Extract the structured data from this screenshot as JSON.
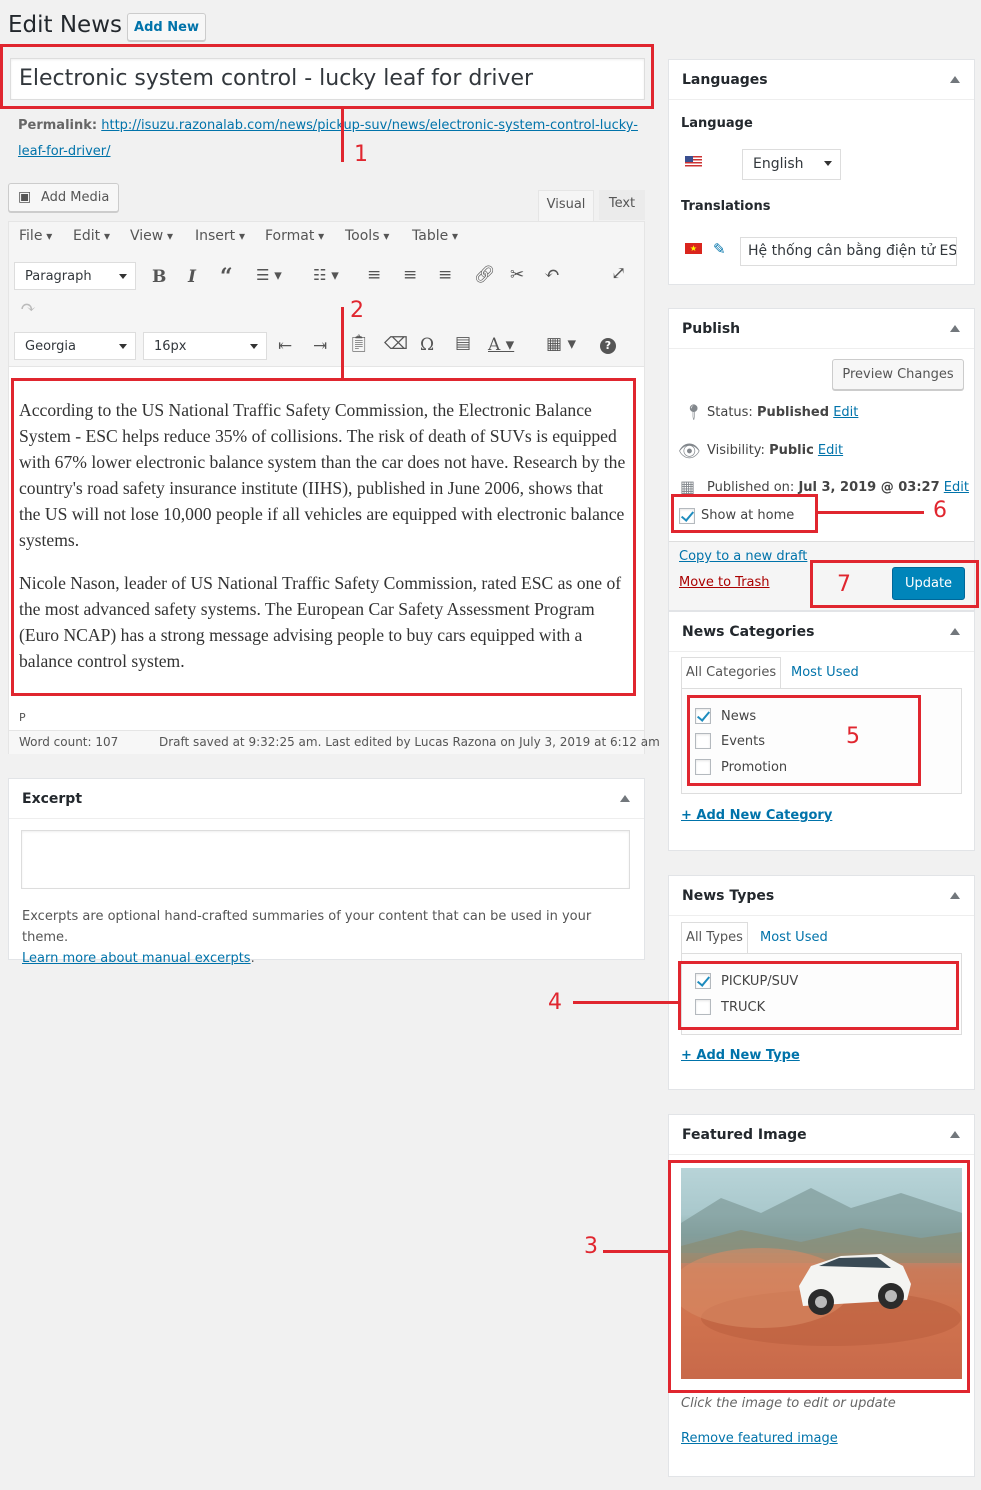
{
  "page": {
    "title": "Edit News",
    "add_new": "Add New",
    "post_title": "Electronic system control - lucky leaf for driver",
    "permalink_label": "Permalink:",
    "permalink_url_line1": "http://isuzu.razonalab.com/news/pickup-suv/news/electronic-system-control-lucky-",
    "permalink_url_line2": "leaf-for-driver/"
  },
  "editor": {
    "add_media": "Add Media",
    "tab_visual": "Visual",
    "tab_text": "Text",
    "menus": [
      "File",
      "Edit",
      "View",
      "Insert",
      "Format",
      "Tools",
      "Table"
    ],
    "paragraph_format": "Paragraph",
    "font_family": "Georgia",
    "font_size": "16px",
    "paragraphs": [
      "According to the US National Traffic Safety Commission, the Electronic Balance System - ESC helps reduce 35% of collisions. The risk of death of SUVs is equipped with 67% lower electronic balance system than the car does not have. Research by the country's road safety insurance institute (IIHS), published in June 2006, shows that the US will not lose 10,000 people if all vehicles are equipped with electronic balance systems.",
      "Nicole Nason, leader of US National Traffic Safety Commission, rated ESC as one of the most advanced safety systems. The European Car Safety Assessment Program (Euro NCAP) has a strong message advising people to buy cars equipped with a balance control system."
    ],
    "path": "P",
    "word_count": "Word count: 107",
    "draft_saved": "Draft saved at 9:32:25 am. Last edited by Lucas Razona on July 3, 2019 at 6:12 am"
  },
  "excerpt": {
    "title": "Excerpt",
    "help": "Excerpts are optional hand-crafted summaries of your content that can be used in your theme.",
    "link": "Learn more about manual excerpts",
    "period": "."
  },
  "languages": {
    "title": "Languages",
    "language_label": "Language",
    "language_value": "English",
    "translations_label": "Translations",
    "translation_value": "Hệ thống cân bằng điện tử ES"
  },
  "publish": {
    "title": "Publish",
    "preview": "Preview Changes",
    "status_label": "Status: ",
    "status_value": "Published",
    "visibility_label": "Visibility: ",
    "visibility_value": "Public",
    "published_label": "Published on: ",
    "published_value": "Jul 3, 2019 @ 03:27",
    "edit": "Edit",
    "show_home": "Show at home",
    "copy_draft": "Copy to a new draft",
    "trash": "Move to Trash",
    "update": "Update"
  },
  "categories": {
    "title": "News Categories",
    "tab_all": "All Categories",
    "tab_used": "Most Used",
    "items": [
      {
        "label": "News",
        "checked": true
      },
      {
        "label": "Events",
        "checked": false
      },
      {
        "label": "Promotion",
        "checked": false
      }
    ],
    "add_new": "+ Add New Category"
  },
  "types": {
    "title": "News Types",
    "tab_all": "All Types",
    "tab_used": "Most Used",
    "items": [
      {
        "label": "PICKUP/SUV",
        "checked": true
      },
      {
        "label": "TRUCK",
        "checked": false
      }
    ],
    "add_new": "+ Add New Type"
  },
  "featured": {
    "title": "Featured Image",
    "hint": "Click the image to edit or update",
    "remove": "Remove featured image"
  },
  "annotations": [
    "1",
    "2",
    "3",
    "4",
    "5",
    "6",
    "7"
  ],
  "colors": {
    "annotation": "#e0262f",
    "primary_button": "#0085ba",
    "link": "#0073aa",
    "trash": "#a00"
  }
}
